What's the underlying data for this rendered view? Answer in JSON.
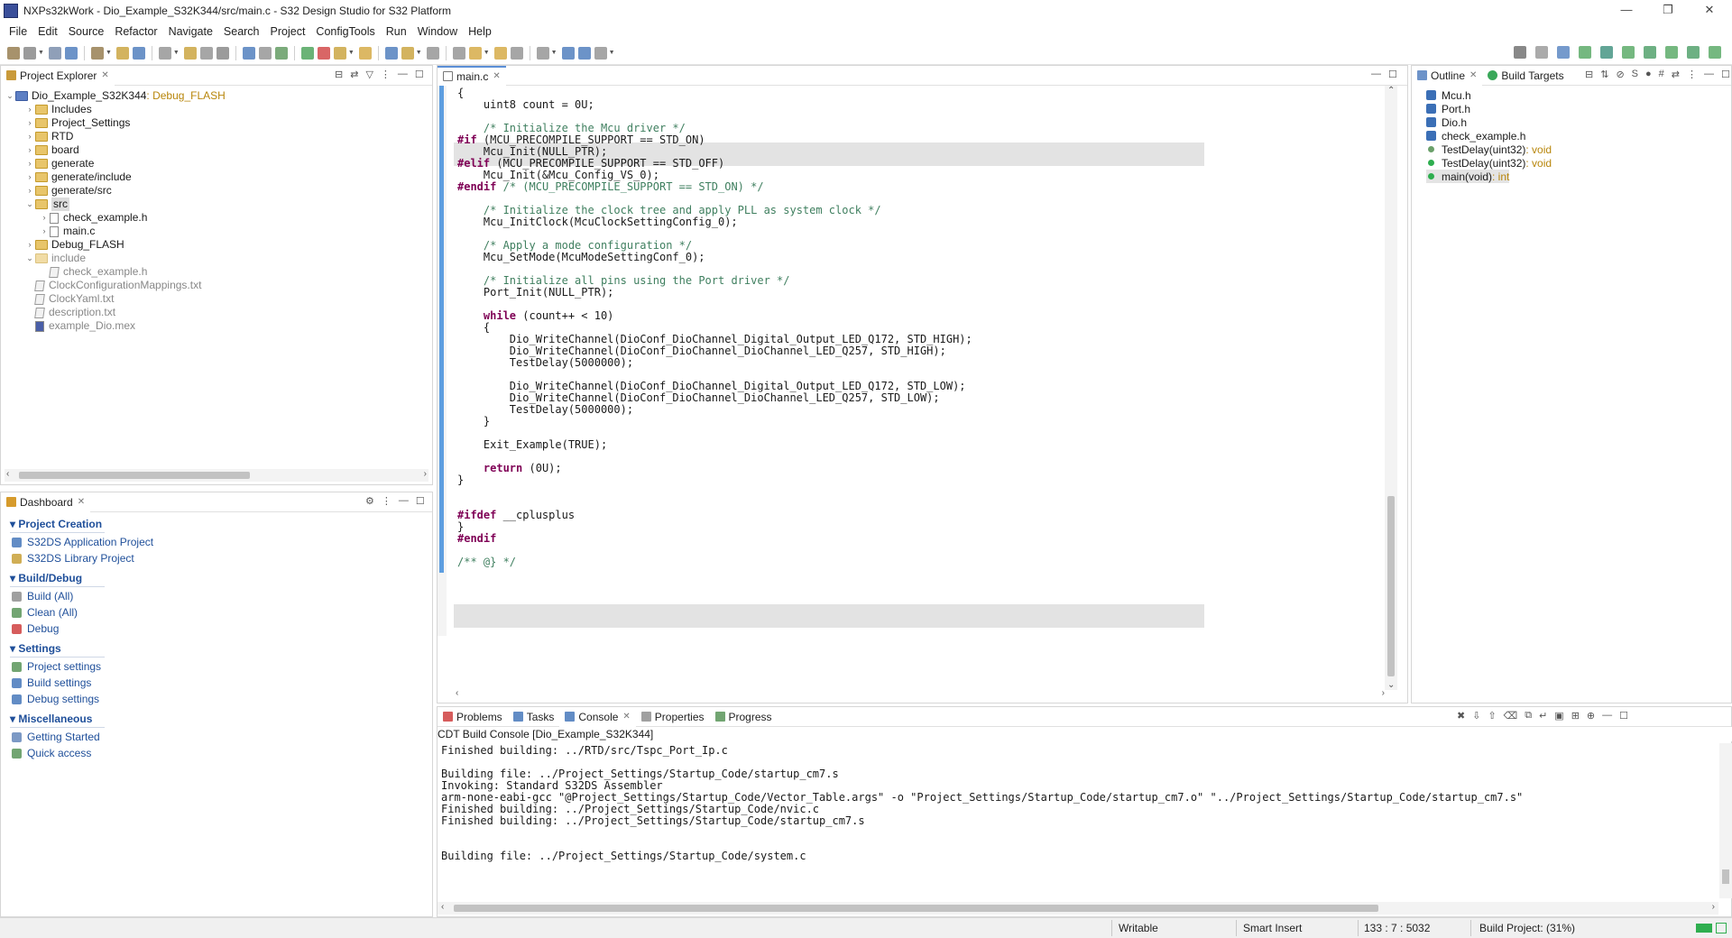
{
  "window": {
    "title": "NXPs32kWork - Dio_Example_S32K344/src/main.c - S32 Design Studio for S32 Platform",
    "app_icon": "S32DS",
    "minimize": "—",
    "maximize": "❐",
    "close": "✕"
  },
  "menu": [
    "File",
    "Edit",
    "Source",
    "Refactor",
    "Navigate",
    "Search",
    "Project",
    "ConfigTools",
    "Run",
    "Window",
    "Help"
  ],
  "project_explorer": {
    "tab_label": "Project Explorer",
    "project_name": "Dio_Example_S32K344",
    "project_config": ": Debug_FLASH",
    "items": [
      {
        "label": "Includes",
        "kind": "folder",
        "twisty": "›"
      },
      {
        "label": "Project_Settings",
        "kind": "folder",
        "twisty": "›"
      },
      {
        "label": "RTD",
        "kind": "folder",
        "twisty": "›"
      },
      {
        "label": "board",
        "kind": "folder",
        "twisty": "›"
      },
      {
        "label": "generate",
        "kind": "folder",
        "twisty": "›"
      },
      {
        "label": "generate/include",
        "kind": "folder",
        "twisty": "›"
      },
      {
        "label": "generate/src",
        "kind": "folder",
        "twisty": "›"
      },
      {
        "label": "src",
        "kind": "folder",
        "twisty": "⌄"
      },
      {
        "label": "check_example.h",
        "kind": "file",
        "twisty": "›"
      },
      {
        "label": "main.c",
        "kind": "file",
        "twisty": "›"
      },
      {
        "label": "Debug_FLASH",
        "kind": "folder",
        "twisty": "›"
      },
      {
        "label": "include",
        "kind": "folder-gray",
        "twisty": "⌄"
      },
      {
        "label": "check_example.h",
        "kind": "txt",
        "twisty": ""
      },
      {
        "label": "ClockConfigurationMappings.txt",
        "kind": "txt",
        "twisty": ""
      },
      {
        "label": "ClockYaml.txt",
        "kind": "txt",
        "twisty": ""
      },
      {
        "label": "description.txt",
        "kind": "txt",
        "twisty": ""
      },
      {
        "label": "example_Dio.mex",
        "kind": "mex",
        "twisty": ""
      }
    ]
  },
  "dashboard": {
    "tab_label": "Dashboard",
    "sections": [
      {
        "title": "Project Creation",
        "items": [
          "S32DS Application Project",
          "S32DS Library Project"
        ]
      },
      {
        "title": "Build/Debug",
        "items": [
          "Build  (All)",
          "Clean  (All)",
          "Debug"
        ]
      },
      {
        "title": "Settings",
        "items": [
          "Project settings",
          "Build settings",
          "Debug settings"
        ]
      },
      {
        "title": "Miscellaneous",
        "items": [
          "Getting Started",
          "Quick access"
        ]
      }
    ]
  },
  "editor": {
    "tab_label": "main.c",
    "lines": [
      "{",
      "    uint8 count = 0U;",
      "",
      "    /* Initialize the Mcu driver */",
      "#if (MCU_PRECOMPILE_SUPPORT == STD_ON)",
      "    Mcu_Init(NULL_PTR);",
      "#elif (MCU_PRECOMPILE_SUPPORT == STD_OFF)",
      "    Mcu_Init(&Mcu_Config_VS_0);",
      "#endif /* (MCU_PRECOMPILE_SUPPORT == STD_ON) */",
      "",
      "    /* Initialize the clock tree and apply PLL as system clock */",
      "    Mcu_InitClock(McuClockSettingConfig_0);",
      "",
      "    /* Apply a mode configuration */",
      "    Mcu_SetMode(McuModeSettingConf_0);",
      "",
      "    /* Initialize all pins using the Port driver */",
      "    Port_Init(NULL_PTR);",
      "",
      "    while (count++ < 10)",
      "    {",
      "        Dio_WriteChannel(DioConf_DioChannel_Digital_Output_LED_Q172, STD_HIGH);",
      "        Dio_WriteChannel(DioConf_DioChannel_DioChannel_LED_Q257, STD_HIGH);",
      "        TestDelay(5000000);",
      "",
      "        Dio_WriteChannel(DioConf_DioChannel_Digital_Output_LED_Q172, STD_LOW);",
      "        Dio_WriteChannel(DioConf_DioChannel_DioChannel_LED_Q257, STD_LOW);",
      "        TestDelay(5000000);",
      "    }",
      "",
      "    Exit_Example(TRUE);",
      "",
      "    return (0U);",
      "}",
      "",
      "",
      "#ifdef __cplusplus",
      "}",
      "#endif",
      "",
      "/** @} */"
    ]
  },
  "outline": {
    "tab_label": "Outline",
    "tab2_label": "Build Targets",
    "items": [
      {
        "label": "Mcu.h",
        "type": ""
      },
      {
        "label": "Port.h",
        "type": ""
      },
      {
        "label": "Dio.h",
        "type": ""
      },
      {
        "label": "check_example.h",
        "type": ""
      },
      {
        "label": "TestDelay(uint32)",
        "type": " : void"
      },
      {
        "label": "TestDelay(uint32)",
        "type": " : void"
      },
      {
        "label": "main(void)",
        "type": " : int"
      }
    ]
  },
  "console": {
    "tabs": [
      "Problems",
      "Tasks",
      "Console",
      "Properties",
      "Progress"
    ],
    "header": "CDT Build Console [Dio_Example_S32K344]",
    "lines": [
      "Finished building: ../RTD/src/Tspc_Port_Ip.c",
      "",
      "Building file: ../Project_Settings/Startup_Code/startup_cm7.s",
      "Invoking: Standard S32DS Assembler",
      "arm-none-eabi-gcc \"@Project_Settings/Startup_Code/Vector_Table.args\" -o \"Project_Settings/Startup_Code/startup_cm7.o\" \"../Project_Settings/Startup_Code/startup_cm7.s\"",
      "Finished building: ../Project_Settings/Startup_Code/nvic.c",
      "Finished building: ../Project_Settings/Startup_Code/startup_cm7.s",
      "",
      "",
      "Building file: ../Project_Settings/Startup_Code/system.c"
    ]
  },
  "status": {
    "writable": "Writable",
    "insert_mode": "Smart Insert",
    "position": "133 : 7 : 5032",
    "build": "Build Project: (31%)"
  },
  "colors": {
    "accent": "#1f4f9a",
    "keyword": "#7f0055",
    "comment": "#3f7f5f",
    "highlight": "#e3e3e3"
  }
}
